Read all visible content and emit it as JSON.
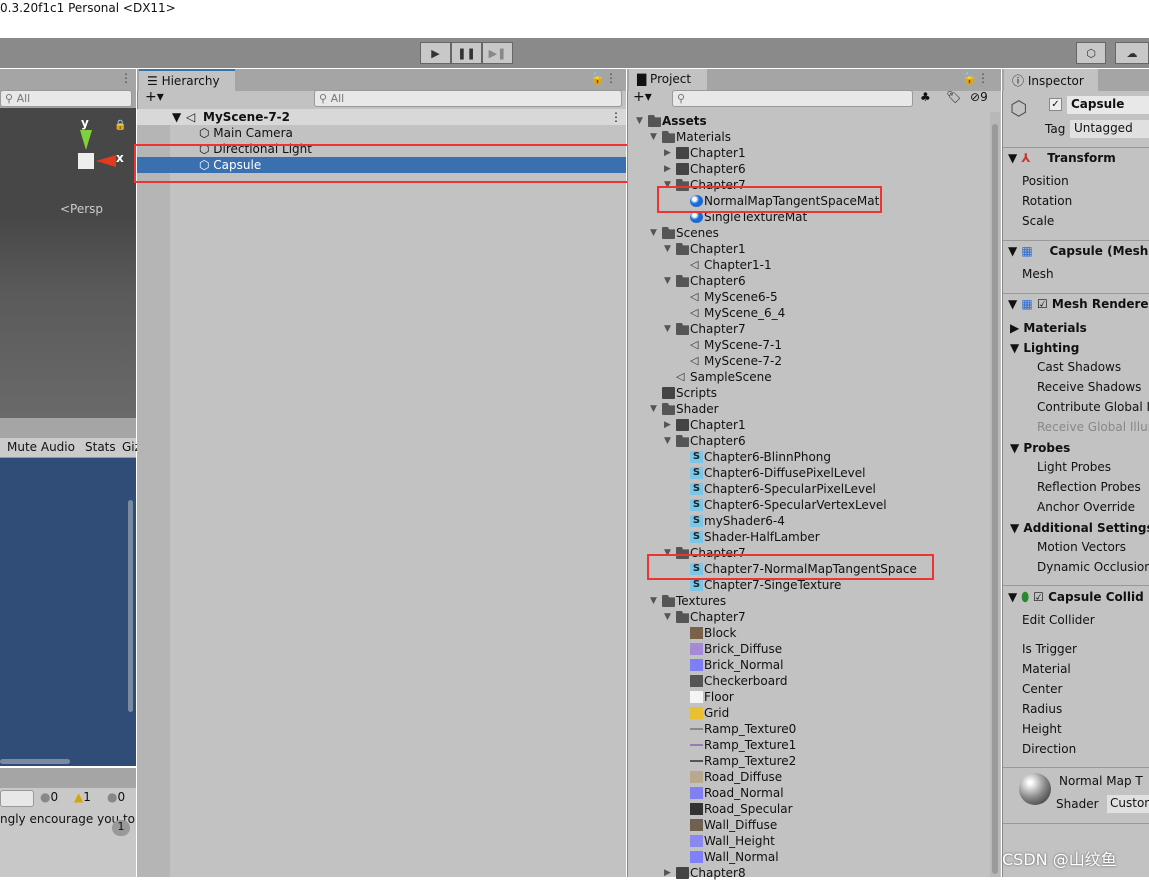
{
  "title": "0.3.20f1c1 Personal <DX11>",
  "toolbar": {
    "play": "▶",
    "pause": "❚❚",
    "step": "▶❚"
  },
  "scene": {
    "search": "All",
    "axis_y": "y",
    "axis_x": "x",
    "persp": "<Persp"
  },
  "game": {
    "mute_audio": "Mute Audio",
    "stats": "Stats",
    "gizmos": "Giz"
  },
  "console": {
    "info_count": "0",
    "warn_count": "1",
    "error_count": "0",
    "message": "ngly encourage you to u",
    "badge": "1"
  },
  "hierarchy": {
    "tab": "Hierarchy",
    "search": "All",
    "scene": "MyScene-7-2",
    "items": [
      "Main Camera",
      "Directional Light",
      "Capsule"
    ],
    "selected": "Capsule"
  },
  "project": {
    "tab": "Project",
    "hidden_count": "9",
    "tree": [
      {
        "label": "Assets",
        "level": 0,
        "type": "folder",
        "state": "open",
        "bold": true
      },
      {
        "label": "Materials",
        "level": 1,
        "type": "folder",
        "state": "open"
      },
      {
        "label": "Chapter1",
        "level": 2,
        "type": "folder",
        "state": "closed"
      },
      {
        "label": "Chapter6",
        "level": 2,
        "type": "folder",
        "state": "closed"
      },
      {
        "label": "Chapter7",
        "level": 2,
        "type": "folder",
        "state": "open"
      },
      {
        "label": "NormalMapTangentSpaceMat",
        "level": 3,
        "type": "material"
      },
      {
        "label": "SingleTextureMat",
        "level": 3,
        "type": "material"
      },
      {
        "label": "Scenes",
        "level": 1,
        "type": "folder",
        "state": "open"
      },
      {
        "label": "Chapter1",
        "level": 2,
        "type": "folder",
        "state": "open"
      },
      {
        "label": "Chapter1-1",
        "level": 3,
        "type": "scene"
      },
      {
        "label": "Chapter6",
        "level": 2,
        "type": "folder",
        "state": "open"
      },
      {
        "label": "MyScene6-5",
        "level": 3,
        "type": "scene"
      },
      {
        "label": "MyScene_6_4",
        "level": 3,
        "type": "scene"
      },
      {
        "label": "Chapter7",
        "level": 2,
        "type": "folder",
        "state": "open"
      },
      {
        "label": "MyScene-7-1",
        "level": 3,
        "type": "scene"
      },
      {
        "label": "MyScene-7-2",
        "level": 3,
        "type": "scene"
      },
      {
        "label": "SampleScene",
        "level": 2,
        "type": "scene"
      },
      {
        "label": "Scripts",
        "level": 1,
        "type": "folder",
        "state": "none"
      },
      {
        "label": "Shader",
        "level": 1,
        "type": "folder",
        "state": "open"
      },
      {
        "label": "Chapter1",
        "level": 2,
        "type": "folder",
        "state": "closed"
      },
      {
        "label": "Chapter6",
        "level": 2,
        "type": "folder",
        "state": "open"
      },
      {
        "label": "Chapter6-BlinnPhong",
        "level": 3,
        "type": "shader"
      },
      {
        "label": "Chapter6-DiffusePixelLevel",
        "level": 3,
        "type": "shader"
      },
      {
        "label": "Chapter6-SpecularPixelLevel",
        "level": 3,
        "type": "shader"
      },
      {
        "label": "Chapter6-SpecularVertexLevel",
        "level": 3,
        "type": "shader"
      },
      {
        "label": "myShader6-4",
        "level": 3,
        "type": "shader"
      },
      {
        "label": "Shader-HalfLamber",
        "level": 3,
        "type": "shader"
      },
      {
        "label": "Chapter7",
        "level": 2,
        "type": "folder",
        "state": "open"
      },
      {
        "label": "Chapter7-NormalMapTangentSpace",
        "level": 3,
        "type": "shader"
      },
      {
        "label": "Chapter7-SingeTexture",
        "level": 3,
        "type": "shader"
      },
      {
        "label": "Textures",
        "level": 1,
        "type": "folder",
        "state": "open"
      },
      {
        "label": "Chapter7",
        "level": 2,
        "type": "folder",
        "state": "open"
      },
      {
        "label": "Block",
        "level": 3,
        "type": "texture",
        "color": "#7a6248"
      },
      {
        "label": "Brick_Diffuse",
        "level": 3,
        "type": "texture",
        "color": "#a58ad8"
      },
      {
        "label": "Brick_Normal",
        "level": 3,
        "type": "texture",
        "color": "#7f7ff5"
      },
      {
        "label": "Checkerboard",
        "level": 3,
        "type": "texture",
        "color": "#555555"
      },
      {
        "label": "Floor",
        "level": 3,
        "type": "texture",
        "color": "#f4f4f4"
      },
      {
        "label": "Grid",
        "level": 3,
        "type": "texture",
        "color": "#e8c030"
      },
      {
        "label": "Ramp_Texture0",
        "level": 3,
        "type": "ramp",
        "color": "#888888"
      },
      {
        "label": "Ramp_Texture1",
        "level": 3,
        "type": "ramp",
        "color": "#9a7ab0"
      },
      {
        "label": "Ramp_Texture2",
        "level": 3,
        "type": "ramp",
        "color": "#555555"
      },
      {
        "label": "Road_Diffuse",
        "level": 3,
        "type": "texture",
        "color": "#b8a890"
      },
      {
        "label": "Road_Normal",
        "level": 3,
        "type": "texture",
        "color": "#8080f0"
      },
      {
        "label": "Road_Specular",
        "level": 3,
        "type": "texture",
        "color": "#333333"
      },
      {
        "label": "Wall_Diffuse",
        "level": 3,
        "type": "texture",
        "color": "#706050"
      },
      {
        "label": "Wall_Height",
        "level": 3,
        "type": "texture",
        "color": "#8a8aee"
      },
      {
        "label": "Wall_Normal",
        "level": 3,
        "type": "texture",
        "color": "#8080f8"
      },
      {
        "label": "Chapter8",
        "level": 2,
        "type": "folder",
        "state": "closed"
      }
    ]
  },
  "inspector": {
    "tab": "Inspector",
    "name": "Capsule",
    "tag_label": "Tag",
    "tag": "Untagged",
    "transform": {
      "title": "Transform",
      "fields": [
        "Position",
        "Rotation",
        "Scale"
      ]
    },
    "mesh_filter": {
      "title": "Capsule (Mesh",
      "fields": [
        "Mesh"
      ]
    },
    "mesh_renderer": {
      "title": "Mesh Rendere",
      "materials": "Materials",
      "lighting": "Lighting",
      "lighting_fields": [
        "Cast Shadows",
        "Receive Shadows",
        "Contribute Global I",
        "Receive Global Illun"
      ],
      "probes": "Probes",
      "probes_fields": [
        "Light Probes",
        "Reflection Probes",
        "Anchor Override"
      ],
      "additional": "Additional Settings",
      "additional_fields": [
        "Motion Vectors",
        "Dynamic Occlusion"
      ]
    },
    "collider": {
      "title": "Capsule Collid",
      "edit": "Edit Collider",
      "fields": [
        "Is Trigger",
        "Material",
        "Center",
        "Radius",
        "Height",
        "Direction"
      ]
    },
    "material": {
      "name": "Normal Map T",
      "shader_label": "Shader",
      "shader": "Custon"
    }
  },
  "watermark": "CSDN @山纹鱼"
}
